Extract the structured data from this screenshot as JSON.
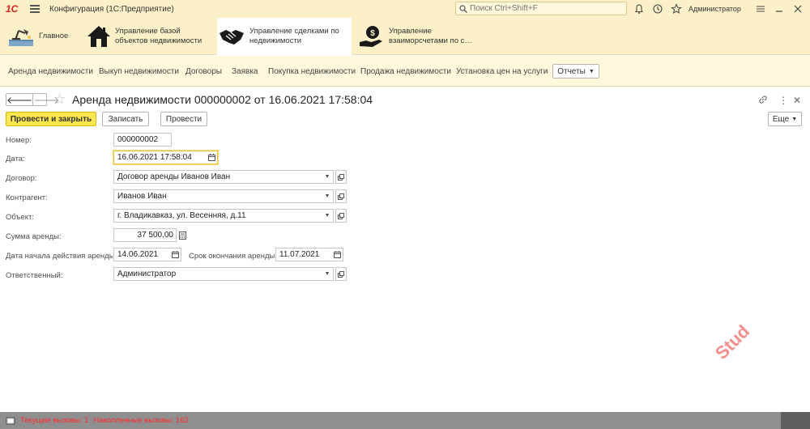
{
  "titlebar": {
    "logo_text": "1С",
    "app_title": "Конфигурация  (1С:Предприятие)",
    "search_placeholder": "Поиск Ctrl+Shift+F",
    "username": "Администратор"
  },
  "sections": [
    {
      "label": "Главное",
      "icon": "desk-lamp-icon"
    },
    {
      "label": "Управление базой объектов недвижимости",
      "icon": "house-icon"
    },
    {
      "label": "Управление сделками по недвижимости",
      "icon": "handshake-icon",
      "active": true
    },
    {
      "label": "Управление взаиморсчетами по с…",
      "icon": "hand-money-icon"
    }
  ],
  "function_panel": {
    "items": [
      "Аренда недвижимости",
      "Выкуп недвижимости",
      "Договоры",
      "Заявка",
      "Покупка недвижимости",
      "Продажа недвижимости",
      "Установка цен на услуги"
    ],
    "reports_label": "Отчеты"
  },
  "form": {
    "title": "Аренда недвижимости 000000002 от 16.06.2021 17:58:04",
    "buttons": {
      "post_close": "Провести и закрыть",
      "save": "Записать",
      "post": "Провести",
      "more": "Еще"
    },
    "fields": {
      "number_label": "Номер:",
      "number_value": "000000002",
      "date_label": "Дата:",
      "date_value": "16.06.2021 17:58:04",
      "contract_label": "Договор:",
      "contract_value": "Договор аренды Иванов Иван",
      "counterparty_label": "Контрагент:",
      "counterparty_value": "Иванов Иван",
      "object_label": "Объект:",
      "object_value": "г. Владикавказ, ул. Весенняя, д.11",
      "rent_sum_label": "Сумма аренды:",
      "rent_sum_value": "37 500,00",
      "start_date_label": "Дата начала действия аренды:",
      "start_date_value": "14.06.2021",
      "end_date_label": "Срок окончания аренды:",
      "end_date_value": "11.07.2021",
      "responsible_label": "Ответственный:",
      "responsible_value": "Администратор"
    }
  },
  "watermark": "Stud",
  "statusbar": {
    "current_calls": "Текущие вызовы: 1",
    "accumulated_calls": "Накопленные вызовы: 162"
  },
  "colors": {
    "header_bg": "#fbf0c8",
    "primary_button": "#fde74c",
    "status_text": "#ff2a2a"
  }
}
